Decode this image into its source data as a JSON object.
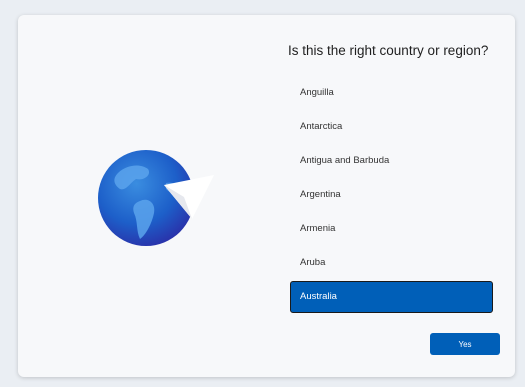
{
  "page": {
    "title": "Is this the right country or region?"
  },
  "countries": {
    "items": [
      {
        "label": "Anguilla"
      },
      {
        "label": "Antarctica"
      },
      {
        "label": "Antigua and Barbuda"
      },
      {
        "label": "Argentina"
      },
      {
        "label": "Armenia"
      },
      {
        "label": "Aruba"
      },
      {
        "label": "Australia"
      }
    ],
    "selected": "Australia"
  },
  "actions": {
    "yes_label": "Yes"
  },
  "colors": {
    "accent": "#005fb8",
    "background": "#eaeef3",
    "card": "#f7f8fa"
  },
  "icons": {
    "illustration": "globe-with-paper-plane-icon"
  }
}
